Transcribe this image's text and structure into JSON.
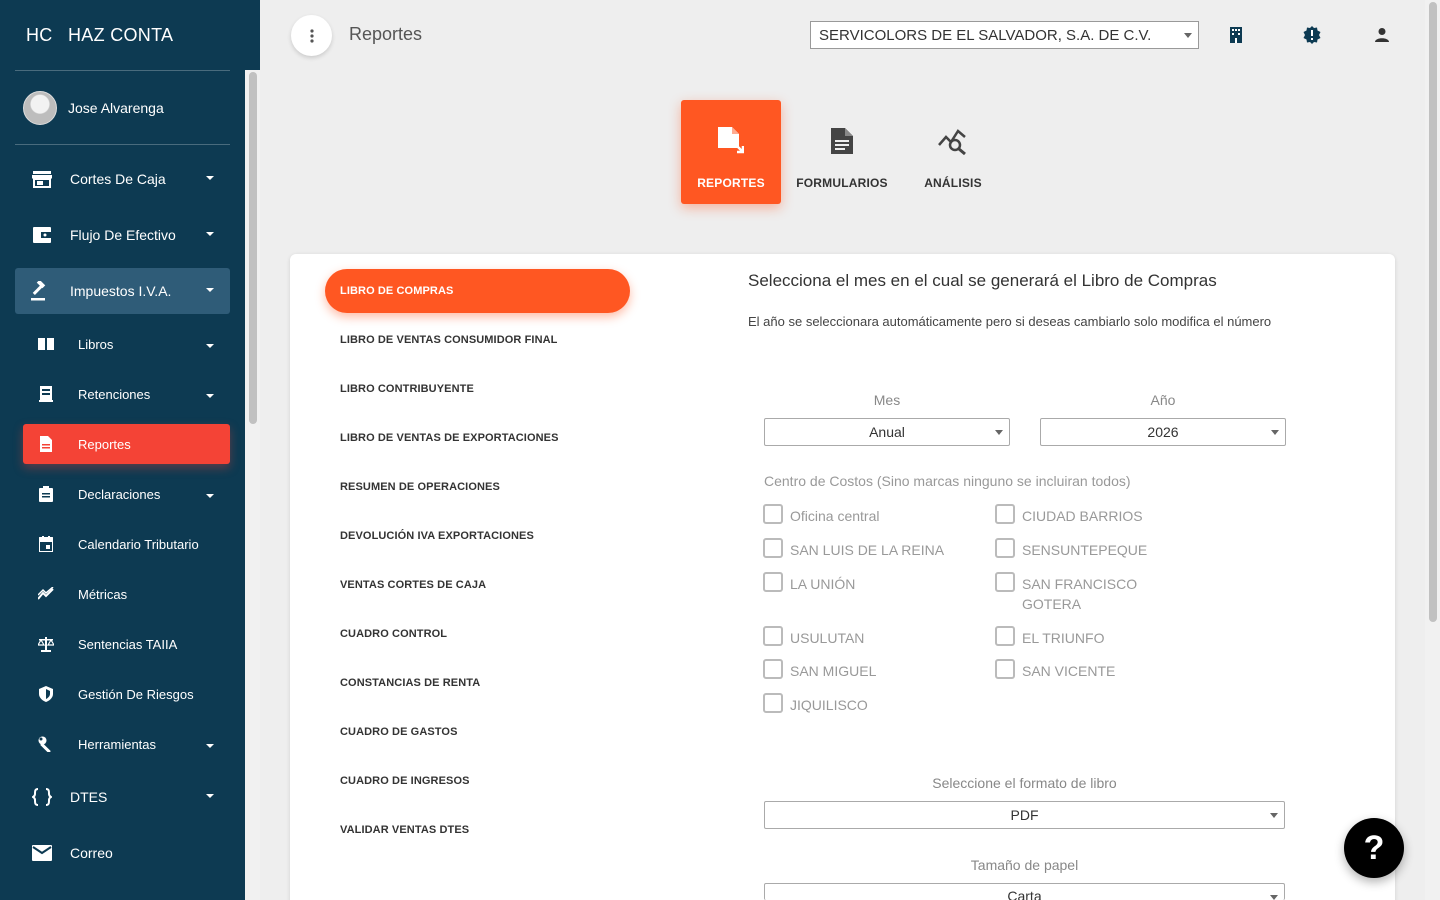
{
  "brand": {
    "mini": "HC",
    "name": "HAZ CONTA"
  },
  "user": {
    "name": "Jose Alvarenga"
  },
  "nav": {
    "cortes": "Cortes De Caja",
    "flujo": "Flujo De Efectivo",
    "impuestos": "Impuestos I.V.A.",
    "libros": "Libros",
    "retenciones": "Retenciones",
    "reportes": "Reportes",
    "declaraciones": "Declaraciones",
    "calendario": "Calendario Tributario",
    "metricas": "Métricas",
    "sentencias": "Sentencias TAIIA",
    "riesgos": "Gestión De Riesgos",
    "herramientas": "Herramientas",
    "dtes": "DTES",
    "correo": "Correo"
  },
  "header": {
    "title": "Reportes",
    "company": "SERVICOLORS DE EL SALVADOR, S.A. DE C.V."
  },
  "tabs": {
    "reportes": "REPORTES",
    "formularios": "FORMULARIOS",
    "analisis": "ANÁLISIS"
  },
  "reports": [
    "LIBRO DE COMPRAS",
    "LIBRO DE VENTAS CONSUMIDOR FINAL",
    "LIBRO CONTRIBUYENTE",
    "LIBRO DE VENTAS DE EXPORTACIONES",
    "RESUMEN DE OPERACIONES",
    "DEVOLUCIÓN IVA EXPORTACIONES",
    "VENTAS CORTES DE CAJA",
    "CUADRO CONTROL",
    "CONSTANCIAS DE RENTA",
    "CUADRO DE GASTOS",
    "CUADRO DE INGRESOS",
    "VALIDAR VENTAS DTES"
  ],
  "form": {
    "title": "Selecciona el mes en el cual se generará el Libro de Compras",
    "desc": "El año se seleccionara automáticamente pero si deseas cambiarlo solo modifica el número",
    "mes_label": "Mes",
    "mes_value": "Anual",
    "anio_label": "Año",
    "anio_value": "2026",
    "cc_label": "Centro de Costos (Sino marcas ninguno se incluiran todos)",
    "cc": {
      "oficina": "Oficina central",
      "ciudad_barrios": "CIUDAD BARRIOS",
      "san_luis": "SAN LUIS DE LA REINA",
      "sensuntepeque": "SENSUNTEPEQUE",
      "la_union": "LA UNIÓN",
      "san_francisco": "SAN FRANCISCO GOTERA",
      "usulutan": "USULUTAN",
      "el_triunfo": "EL TRIUNFO",
      "san_miguel": "SAN MIGUEL",
      "san_vicente": "SAN VICENTE",
      "jiquilisco": "JIQUILISCO"
    },
    "formato_label": "Seleccione el formato de libro",
    "formato_value": "PDF",
    "papel_label": "Tamaño de papel",
    "papel_value": "Carta"
  },
  "help": "?",
  "colors": {
    "sidebar": "#0d3a52",
    "accent": "#ff5722",
    "active_sub": "#f44336"
  }
}
